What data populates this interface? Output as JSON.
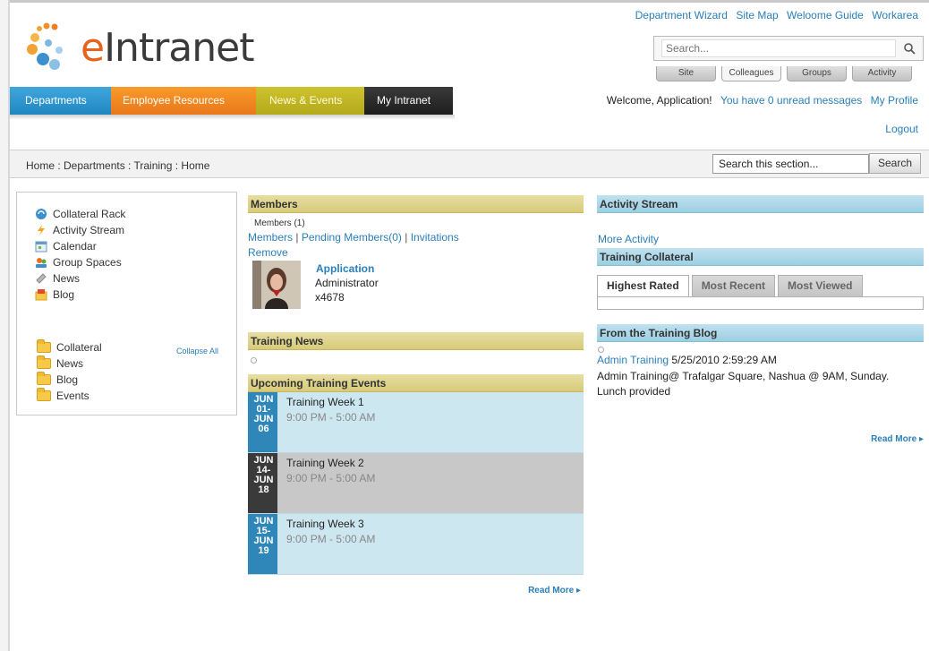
{
  "brand": {
    "name": "eIntranet",
    "name_accent": "e",
    "name_rest": "Intranet",
    "accent_color": "#e8621a"
  },
  "top_links": [
    "Department Wizard",
    "Site Map",
    "Weloome Guide",
    "Workarea"
  ],
  "search": {
    "placeholder": "Search...",
    "tabs": [
      "Site",
      "Colleagues",
      "Groups",
      "Activity"
    ]
  },
  "nav": {
    "departments": "Departments",
    "employee_resources": "Employee Resources",
    "news_events": "News & Events",
    "my_intranet": "My Intranet"
  },
  "welcome": {
    "greeting": "Welcome, Application!",
    "messages": "You have 0 unread messages",
    "profile": "My Profile",
    "logout": "Logout"
  },
  "breadcrumb": {
    "path": "Home : Departments : Training : Home",
    "search_value": "Search this section...",
    "search_button": "Search"
  },
  "sidebar": {
    "items": [
      {
        "label": "Collateral Rack",
        "icon": "collateral-rack-icon"
      },
      {
        "label": "Activity Stream",
        "icon": "activity-stream-icon"
      },
      {
        "label": "Calendar",
        "icon": "calendar-icon"
      },
      {
        "label": "Group Spaces",
        "icon": "group-spaces-icon"
      },
      {
        "label": "News",
        "icon": "news-icon"
      },
      {
        "label": "Blog",
        "icon": "blog-icon"
      }
    ],
    "folders": [
      "Collateral",
      "News",
      "Blog",
      "Events"
    ],
    "collapse_all": "Collapse All"
  },
  "members": {
    "title": "Members",
    "count": "Members (1)",
    "link_members": "Members",
    "link_pending": "Pending Members(0)",
    "link_invitations": "Invitations",
    "separator": "|",
    "remove": "Remove",
    "member": {
      "name": "Application",
      "role": "Administrator",
      "ext": "x4678"
    }
  },
  "training_news": {
    "title": "Training News"
  },
  "events": {
    "title": "Upcoming Training Events",
    "items": [
      {
        "date_lines": [
          "JUN",
          "01-",
          "JUN",
          "06"
        ],
        "title": "Training Week 1",
        "time": "9:00 PM - 5:00 AM"
      },
      {
        "date_lines": [
          "JUN",
          "14-",
          "JUN",
          "18"
        ],
        "title": "Training Week 2",
        "time": "9:00 PM - 5:00 AM"
      },
      {
        "date_lines": [
          "JUN",
          "15-",
          "JUN",
          "19"
        ],
        "title": "Training Week 3",
        "time": "9:00 PM - 5:00 AM"
      }
    ],
    "read_more": "Read More ▸"
  },
  "activity": {
    "title": "Activity Stream",
    "more": "More Activity"
  },
  "collateral": {
    "title": "Training Collateral",
    "tabs": [
      "Highest Rated",
      "Most Recent",
      "Most Viewed"
    ]
  },
  "blog": {
    "title": "From the Training Blog",
    "author": "Admin Training",
    "date": "5/25/2010 2:59:29 AM",
    "body": "Admin Training@ Trafalgar Square, Nashua @ 9AM, Sunday. Lunch provided",
    "read_more": "Read More ▸"
  },
  "colors": {
    "blue": "#2a7fb8",
    "orange": "#e9781a",
    "olive": "#b4a91a",
    "dark": "#1d1d1d"
  }
}
